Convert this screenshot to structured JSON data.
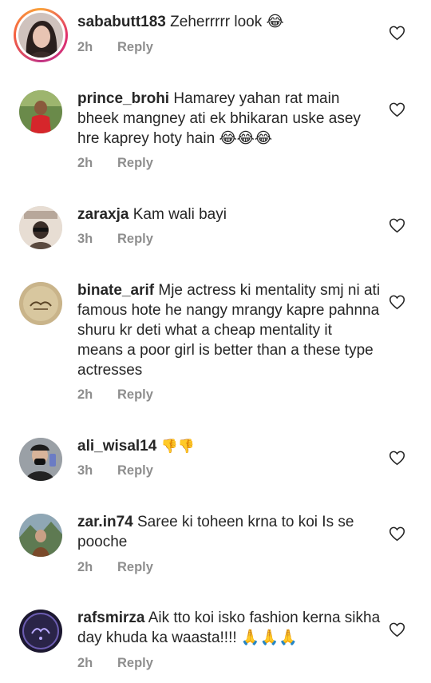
{
  "comments": [
    {
      "username": "sababutt183",
      "text": " Zeherrrrr look 😂",
      "time": "2h",
      "reply": "Reply"
    },
    {
      "username": "prince_brohi",
      "text": " Hamarey yahan rat main bheek mangney ati ek bhikaran uske asey hre kaprey hoty hain 😂😂😂",
      "time": "2h",
      "reply": "Reply"
    },
    {
      "username": "zaraxja",
      "text": " Kam wali bayi",
      "time": "3h",
      "reply": "Reply"
    },
    {
      "username": "binate_arif",
      "text": " Mje actress ki mentality smj ni ati famous hote he nangy mrangy kapre pahnna shuru kr deti what a cheap mentality it means a poor girl is better than a these type actresses",
      "time": "2h",
      "reply": "Reply"
    },
    {
      "username": "ali_wisal14",
      "text": " 👎👎",
      "time": "3h",
      "reply": "Reply"
    },
    {
      "username": "zar.in74",
      "text": " Saree ki toheen krna to koi Is se pooche",
      "time": "2h",
      "reply": "Reply"
    },
    {
      "username": "rafsmirza",
      "text": " Aik tto koi isko fashion kerna sikha day khuda ka waasta!!!! 🙏🙏🙏",
      "time": "2h",
      "reply": "Reply"
    }
  ],
  "icons": {
    "like": "heart-outline-icon"
  },
  "colors": {
    "text": "#262626",
    "meta": "#8e8e8e",
    "story_ring": "#e1306c"
  }
}
